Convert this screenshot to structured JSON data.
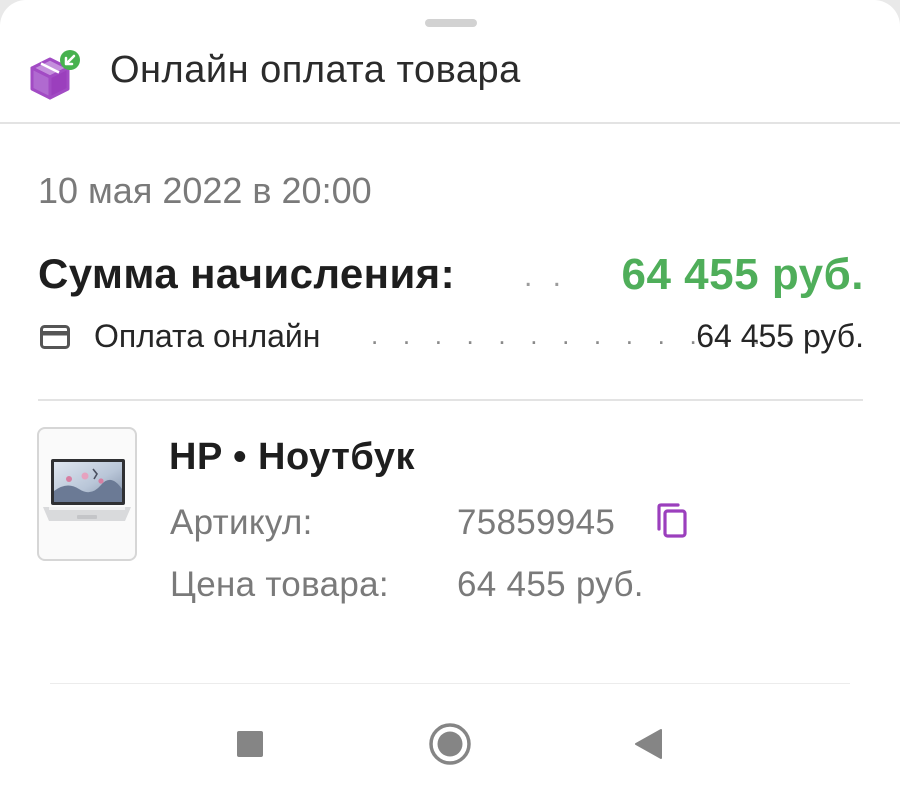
{
  "header": {
    "title": "Онлайн оплата товара",
    "icon": "package-return-icon",
    "icon_colors": {
      "box": "#a24bc4",
      "badge": "#47b24f"
    }
  },
  "date": "10 мая 2022 в 20:00",
  "summary": {
    "label": "Сумма начисления:",
    "dots": ". .",
    "value": "64 455 руб.",
    "value_color": "#4fae5a"
  },
  "payment": {
    "icon": "credit-card-icon",
    "label": "Оплата онлайн",
    "dots": ". . . . . . . . . . . . . .",
    "value": "64 455 руб."
  },
  "product": {
    "thumbnail": "laptop-thumbnail",
    "title": "HP • Ноутбук",
    "article_label": "Артикул:",
    "article_value": "75859945",
    "copy_icon": "copy-icon",
    "accent_color": "#9b3fbd",
    "price_label": "Цена товара:",
    "price_value": "64 455 руб."
  },
  "navbar": {
    "buttons": [
      "recents-square-icon",
      "home-circle-icon",
      "back-triangle-icon"
    ]
  }
}
